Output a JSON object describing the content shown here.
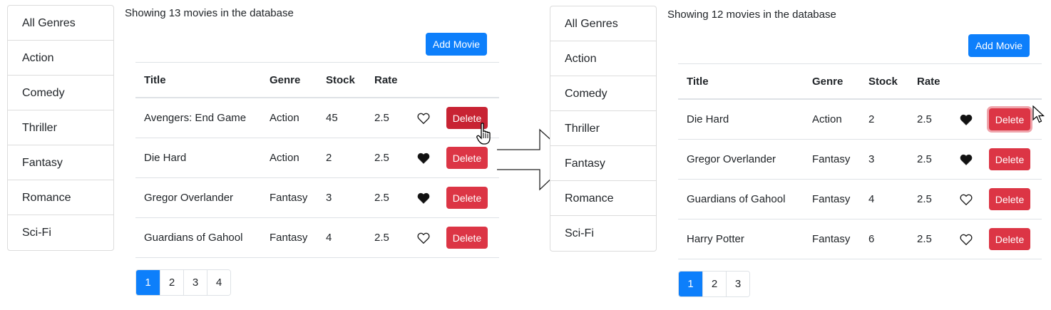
{
  "genres": [
    "All Genres",
    "Action",
    "Comedy",
    "Thriller",
    "Fantasy",
    "Romance",
    "Sci-Fi"
  ],
  "left": {
    "summary": "Showing 13 movies in the database",
    "add_label": "Add Movie",
    "headers": {
      "title": "Title",
      "genre": "Genre",
      "stock": "Stock",
      "rate": "Rate"
    },
    "rows": [
      {
        "title": "Avengers: End Game",
        "genre": "Action",
        "stock": "45",
        "rate": "2.5",
        "liked": false,
        "delete": "Delete"
      },
      {
        "title": "Die Hard",
        "genre": "Action",
        "stock": "2",
        "rate": "2.5",
        "liked": true,
        "delete": "Delete"
      },
      {
        "title": "Gregor Overlander",
        "genre": "Fantasy",
        "stock": "3",
        "rate": "2.5",
        "liked": true,
        "delete": "Delete"
      },
      {
        "title": "Guardians of Gahool",
        "genre": "Fantasy",
        "stock": "4",
        "rate": "2.5",
        "liked": false,
        "delete": "Delete"
      }
    ],
    "pages": [
      "1",
      "2",
      "3",
      "4"
    ],
    "active_page": "1"
  },
  "right": {
    "summary": "Showing 12 movies in the database",
    "add_label": "Add Movie",
    "headers": {
      "title": "Title",
      "genre": "Genre",
      "stock": "Stock",
      "rate": "Rate"
    },
    "rows": [
      {
        "title": "Die Hard",
        "genre": "Action",
        "stock": "2",
        "rate": "2.5",
        "liked": true,
        "delete": "Delete"
      },
      {
        "title": "Gregor Overlander",
        "genre": "Fantasy",
        "stock": "3",
        "rate": "2.5",
        "liked": true,
        "delete": "Delete"
      },
      {
        "title": "Guardians of Gahool",
        "genre": "Fantasy",
        "stock": "4",
        "rate": "2.5",
        "liked": false,
        "delete": "Delete"
      },
      {
        "title": "Harry Potter",
        "genre": "Fantasy",
        "stock": "6",
        "rate": "2.5",
        "liked": false,
        "delete": "Delete"
      }
    ],
    "pages": [
      "1",
      "2",
      "3"
    ],
    "active_page": "1"
  },
  "colors": {
    "primary": "#0d7ffb",
    "danger": "#dc3545",
    "danger_hover": "#c82333"
  },
  "icons": {
    "liked": "heart-filled-icon",
    "not_liked": "heart-outline-icon",
    "transition": "arrow-right-icon"
  }
}
